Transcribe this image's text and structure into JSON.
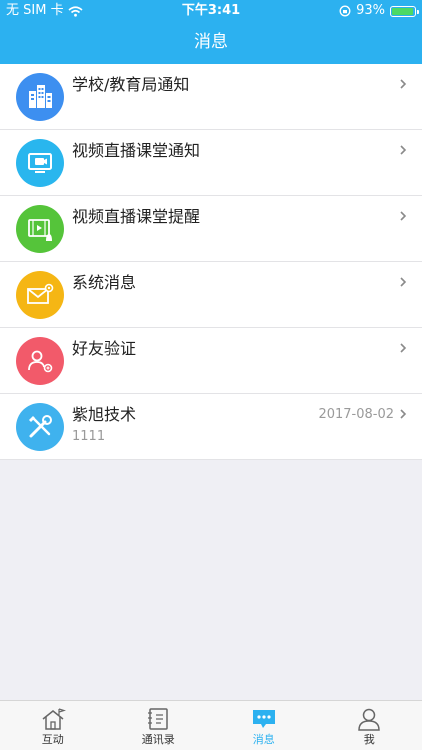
{
  "status_bar": {
    "carrier": "无 SIM 卡",
    "time": "下午3:41",
    "battery": "93%"
  },
  "header": {
    "title": "消息"
  },
  "rows": [
    {
      "title": "学校/教育局通知",
      "subtitle": "",
      "date": "",
      "color": "#3d8ff0",
      "icon": "building-icon"
    },
    {
      "title": "视频直播课堂通知",
      "subtitle": "",
      "date": "",
      "color": "#29b6ee",
      "icon": "video-screen-icon"
    },
    {
      "title": "视频直播课堂提醒",
      "subtitle": "",
      "date": "",
      "color": "#55c43a",
      "icon": "film-bell-icon"
    },
    {
      "title": "系统消息",
      "subtitle": "",
      "date": "",
      "color": "#f5b614",
      "icon": "envelope-gear-icon"
    },
    {
      "title": "好友验证",
      "subtitle": "",
      "date": "",
      "color": "#f25a6a",
      "icon": "user-verify-icon"
    },
    {
      "title": "紫旭技术",
      "subtitle": "1111",
      "date": "2017-08-02",
      "color": "#3fb2ee",
      "icon": "tools-icon"
    }
  ],
  "tabs": [
    {
      "label": "互动",
      "icon": "home-flag-icon"
    },
    {
      "label": "通讯录",
      "icon": "contacts-book-icon"
    },
    {
      "label": "消息",
      "icon": "chat-bubble-icon",
      "active": true
    },
    {
      "label": "我",
      "icon": "person-icon"
    }
  ],
  "colors": {
    "accent": "#2cb1f0",
    "background": "#efeff4"
  }
}
